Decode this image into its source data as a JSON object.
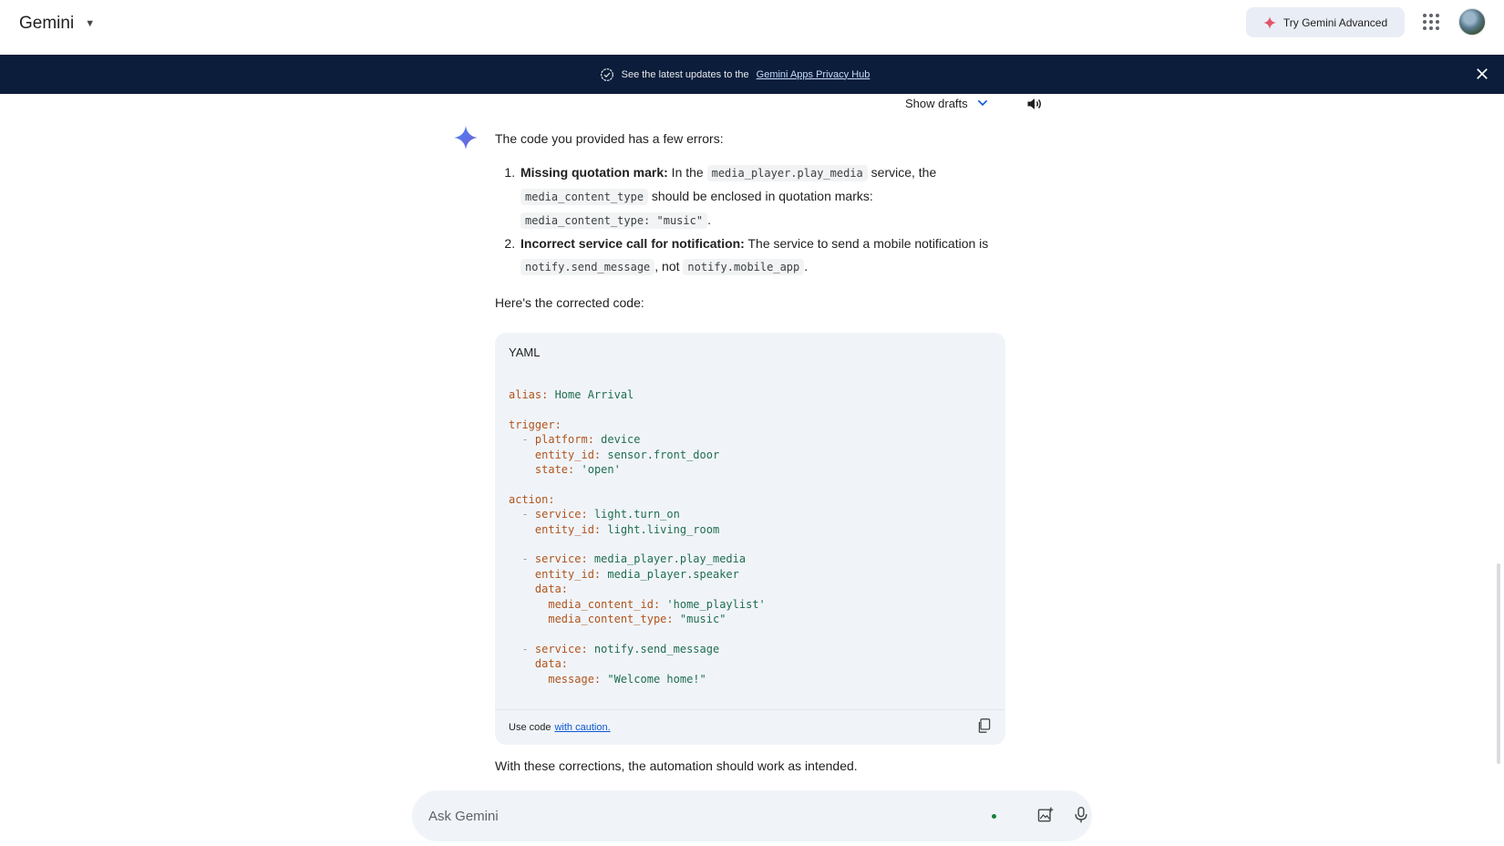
{
  "header": {
    "brand": "Gemini",
    "try_advanced": "Try Gemini Advanced"
  },
  "banner": {
    "text": "See the latest updates to the",
    "link": "Gemini Apps Privacy Hub"
  },
  "response_controls": {
    "show_drafts": "Show drafts"
  },
  "response": {
    "intro": "The code you provided has a few errors:",
    "items": [
      {
        "title": "Missing quotation mark:",
        "t1": " In the ",
        "c1": "media_player.play_media",
        "t2": " service, the ",
        "c2": "media_content_type",
        "t3": " should be enclosed in quotation marks: ",
        "c3": "media_content_type: \"music\"",
        "t4": "."
      },
      {
        "title": "Incorrect service call for notification:",
        "t1": " The service to send a mobile notification is ",
        "c1": "notify.send_message",
        "t2": ", not ",
        "c2": "notify.mobile_app",
        "t3": "."
      }
    ],
    "corrected_intro": "Here's the corrected code:",
    "closing": "With these corrections, the automation should work as intended."
  },
  "code_block": {
    "language": "YAML",
    "footer_text": "Use code",
    "footer_link": "with caution.",
    "lines": [
      {
        "k": "alias:",
        "v": " Home Arrival"
      },
      {
        "k": "",
        "v": ""
      },
      {
        "k": "trigger:",
        "v": ""
      },
      {
        "d": "  - ",
        "k": "platform:",
        "v": " device"
      },
      {
        "d": "    ",
        "k": "entity_id:",
        "v": " sensor.front_door"
      },
      {
        "d": "    ",
        "k": "state:",
        "v": " 'open'"
      },
      {
        "k": "",
        "v": ""
      },
      {
        "k": "action:",
        "v": ""
      },
      {
        "d": "  - ",
        "k": "service:",
        "v": " light.turn_on"
      },
      {
        "d": "    ",
        "k": "entity_id:",
        "v": " light.living_room"
      },
      {
        "k": "",
        "v": ""
      },
      {
        "d": "  - ",
        "k": "service:",
        "v": " media_player.play_media"
      },
      {
        "d": "    ",
        "k": "entity_id:",
        "v": " media_player.speaker"
      },
      {
        "d": "    ",
        "k": "data:",
        "v": ""
      },
      {
        "d": "      ",
        "k": "media_content_id:",
        "v": " 'home_playlist'"
      },
      {
        "d": "      ",
        "k": "media_content_type:",
        "v": " \"music\""
      },
      {
        "k": "",
        "v": ""
      },
      {
        "d": "  - ",
        "k": "service:",
        "v": " notify.send_message"
      },
      {
        "d": "    ",
        "k": "data:",
        "v": ""
      },
      {
        "d": "      ",
        "k": "message:",
        "v": " \"Welcome home!\""
      }
    ]
  },
  "input": {
    "placeholder": "Ask Gemini"
  },
  "icons": {
    "brand_caret": "caret-down-icon",
    "spark": "gemini-spark-icon",
    "apps": "apps-grid-icon",
    "banner_check": "shield-check-icon",
    "banner_close": "close-icon",
    "drafts_chevron": "chevron-down-icon",
    "speaker": "speaker-icon",
    "copy": "copy-icon",
    "image_upload": "image-upload-icon",
    "mic": "mic-icon"
  },
  "colors": {
    "banner_bg": "#0b1d3a",
    "accent_blue": "#0b57d0",
    "code_bg": "#f0f4f9",
    "yaml_key": "#b1541b",
    "yaml_value": "#1f6d4e"
  }
}
